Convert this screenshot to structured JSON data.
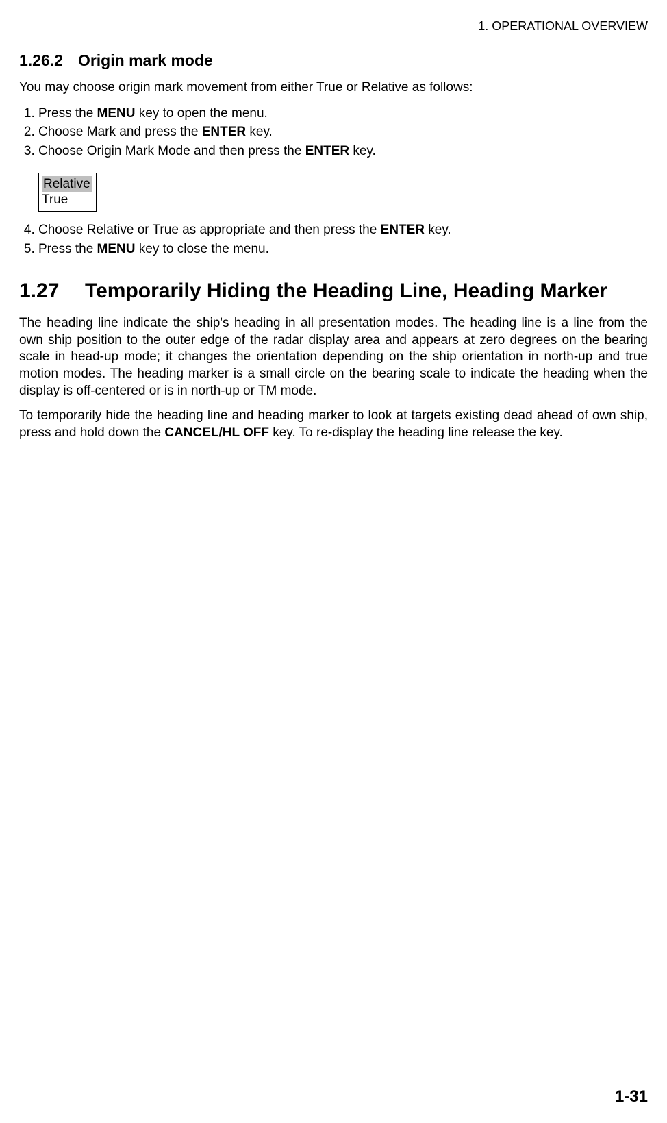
{
  "runningHeader": "1. OPERATIONAL OVERVIEW",
  "subsection": {
    "number": "1.26.2",
    "title": "Origin mark mode"
  },
  "intro": "You may choose origin mark movement from either True or Relative as follows:",
  "stepsA": {
    "s1a": "Press the ",
    "s1b": "MENU",
    "s1c": " key to open the menu.",
    "s2a": "Choose Mark and press the ",
    "s2b": "ENTER",
    "s2c": " key.",
    "s3a": "Choose Origin Mark Mode and then press the ",
    "s3b": "ENTER",
    "s3c": " key."
  },
  "optionBox": {
    "selected": "Relative",
    "other": "True"
  },
  "stepsB": {
    "s4a": "Choose Relative or True as appropriate and then press the ",
    "s4b": "ENTER",
    "s4c": " key.",
    "s5a": "Press the ",
    "s5b": "MENU",
    "s5c": " key to close the menu."
  },
  "section": {
    "number": "1.27",
    "title": "Temporarily Hiding the Heading Line, Heading Marker"
  },
  "para1": "The heading line indicate the ship's heading in all presentation modes. The heading line is a line from the own ship position to the outer edge of the radar display area and appears at zero degrees on the bearing scale in head-up mode; it changes the orientation depending on the ship orientation in north-up and true motion modes. The heading marker is a small circle on the bearing scale to indicate the heading when the display is off-centered or is in north-up or TM mode.",
  "para2a": "To temporarily hide the heading line and heading marker to look at targets existing dead ahead of own ship, press and hold down the ",
  "para2b": "CANCEL/HL OFF",
  "para2c": " key. To re-display the heading line release the key.",
  "pageNumber": "1-31"
}
